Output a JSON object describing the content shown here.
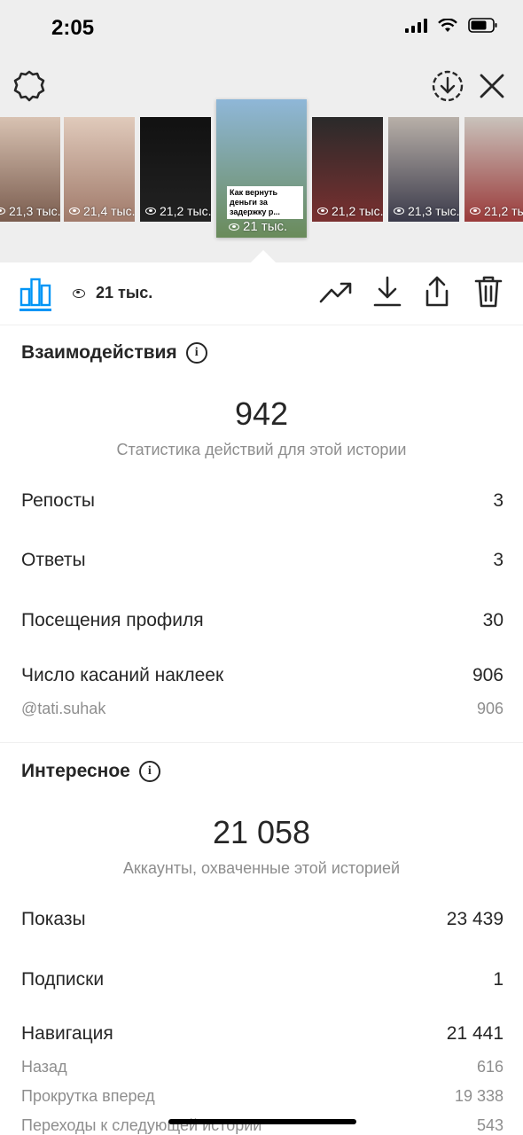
{
  "status_bar": {
    "time": "2:05"
  },
  "thumbnails": [
    {
      "views": "21,3 тыс.",
      "colors": [
        "#d8c2b2",
        "#7a5c4e"
      ],
      "selected": false
    },
    {
      "views": "21,4 тыс.",
      "colors": [
        "#e0cabb",
        "#a07a6a"
      ],
      "selected": false
    },
    {
      "views": "21,2 тыс.",
      "colors": [
        "#111111",
        "#222222"
      ],
      "selected": false
    },
    {
      "views": "21 тыс.",
      "colors": [
        "#8fb7d8",
        "#6a8b5a"
      ],
      "selected": true,
      "caption": "Как вернуть деньги за задержку р..."
    },
    {
      "views": "21,2 тыс.",
      "colors": [
        "#2a2a2a",
        "#7a3030"
      ],
      "selected": false
    },
    {
      "views": "21,3 тыс.",
      "colors": [
        "#b8b0a8",
        "#3a3a4a"
      ],
      "selected": false
    },
    {
      "views": "21,2 тыс.",
      "colors": [
        "#c9c2bb",
        "#9a3a3a"
      ],
      "selected": false
    }
  ],
  "toolbar": {
    "views": "21 тыс."
  },
  "interactions": {
    "title": "Взаимодействия",
    "total": "942",
    "subtitle": "Статистика действий для этой истории",
    "rows": [
      {
        "label": "Репосты",
        "value": "3"
      },
      {
        "label": "Ответы",
        "value": "3"
      },
      {
        "label": "Посещения профиля",
        "value": "30"
      },
      {
        "label": "Число касаний наклеек",
        "value": "906"
      }
    ],
    "sub_rows": [
      {
        "label": "@tati.suhak",
        "value": "906"
      }
    ]
  },
  "discovery": {
    "title": "Интересное",
    "total": "21 058",
    "subtitle": "Аккаунты, охваченные этой историей",
    "rows": [
      {
        "label": "Показы",
        "value": "23 439"
      },
      {
        "label": "Подписки",
        "value": "1"
      },
      {
        "label": "Навигация",
        "value": "21 441"
      }
    ],
    "sub_rows": [
      {
        "label": "Назад",
        "value": "616"
      },
      {
        "label": "Прокрутка вперед",
        "value": "19 338"
      },
      {
        "label": "Переходы к следующей истории",
        "value": "543"
      }
    ]
  },
  "colors": {
    "accent": "#0095f6",
    "text": "#262626",
    "muted": "#8e8e8e"
  }
}
